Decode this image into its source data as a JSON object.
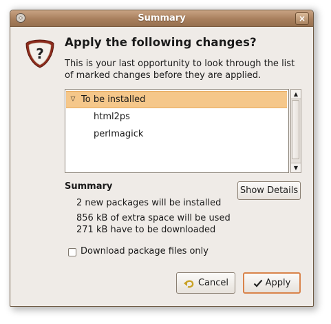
{
  "window": {
    "title": "Summary",
    "close_glyph": "×"
  },
  "dialog": {
    "heading": "Apply the following changes?",
    "description": "This is your last opportunity to look through the list of marked changes before they are applied.",
    "icon": "question-shield-icon"
  },
  "changes": {
    "group_label": "To be installed",
    "group_expanded": true,
    "packages": [
      "html2ps",
      "perlmagick"
    ]
  },
  "summary": {
    "title": "Summary",
    "new_packages": "2 new packages will be installed",
    "extra_space": "856 kB of extra space will be used",
    "download_size": "271 kB have to be downloaded"
  },
  "buttons": {
    "show_details": "Show Details",
    "cancel": "Cancel",
    "apply": "Apply"
  },
  "options": {
    "download_only_label": "Download package files only",
    "download_only_checked": false
  },
  "colors": {
    "titlebar": "#a87f5d",
    "selection": "#f5c78a",
    "default_button_border": "#d9834a"
  }
}
